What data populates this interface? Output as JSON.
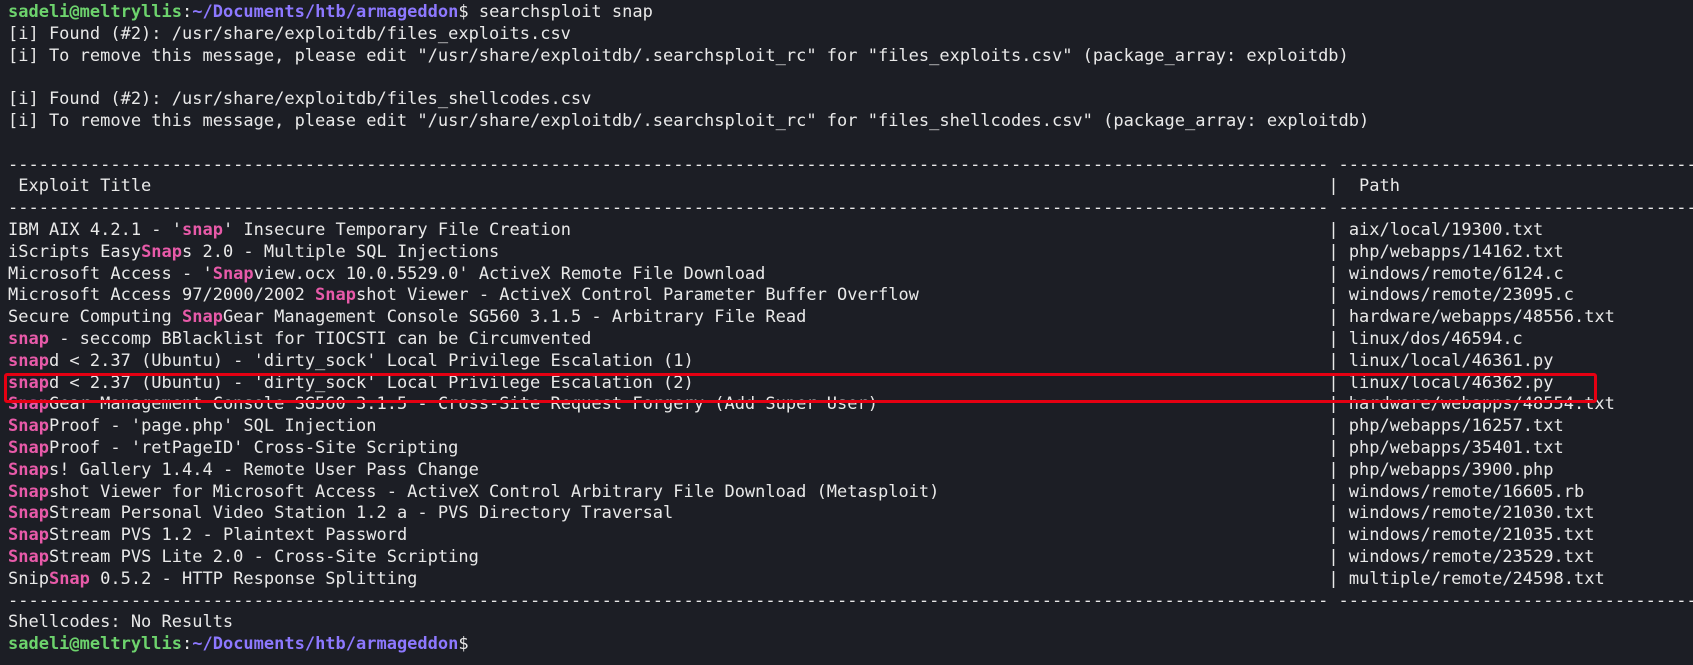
{
  "prompt": {
    "user_host": "sadeli@meltryllis",
    "separator": ":",
    "cwd": "~/Documents/htb/armageddon",
    "symbol": "$ ",
    "command": "searchsploit snap"
  },
  "messages": [
    "[i] Found (#2): /usr/share/exploitdb/files_exploits.csv",
    "[i] To remove this message, please edit \"/usr/share/exploitdb/.searchsploit_rc\" for \"files_exploits.csv\" (package_array: exploitdb)",
    "",
    "[i] Found (#2): /usr/share/exploitdb/files_shellcodes.csv",
    "[i] To remove this message, please edit \"/usr/share/exploitdb/.searchsploit_rc\" for \"files_shellcodes.csv\" (package_array: exploitdb)",
    ""
  ],
  "table": {
    "columns": [
      "Exploit Title",
      "Path"
    ],
    "rows": [
      {
        "pre": "IBM AIX 4.2.1 - '",
        "hl": "snap",
        "post": "' Insecure Temporary File Creation",
        "path": "aix/local/19300.txt"
      },
      {
        "pre": "iScripts Easy",
        "hl": "Snap",
        "post": "s 2.0 - Multiple SQL Injections",
        "path": "php/webapps/14162.txt"
      },
      {
        "pre": "Microsoft Access - '",
        "hl": "Snap",
        "post": "view.ocx 10.0.5529.0' ActiveX Remote File Download",
        "path": "windows/remote/6124.c"
      },
      {
        "pre": "Microsoft Access 97/2000/2002 ",
        "hl": "Snap",
        "post": "shot Viewer - ActiveX Control Parameter Buffer Overflow",
        "path": "windows/remote/23095.c"
      },
      {
        "pre": "Secure Computing ",
        "hl": "Snap",
        "post": "Gear Management Console SG560 3.1.5 - Arbitrary File Read",
        "path": "hardware/webapps/48556.txt"
      },
      {
        "pre": "",
        "hl": "snap",
        "post": " - seccomp BBlacklist for TIOCSTI can be Circumvented",
        "path": "linux/dos/46594.c"
      },
      {
        "pre": "",
        "hl": "snap",
        "post": "d < 2.37 (Ubuntu) - 'dirty_sock' Local Privilege Escalation (1)",
        "path": "linux/local/46361.py"
      },
      {
        "pre": "",
        "hl": "snap",
        "post": "d < 2.37 (Ubuntu) - 'dirty_sock' Local Privilege Escalation (2)",
        "path": "linux/local/46362.py"
      },
      {
        "pre": "",
        "hl": "Snap",
        "post": "Gear Management Console SG560 3.1.5 - Cross-Site Request Forgery (Add Super User)",
        "path": "hardware/webapps/48554.txt"
      },
      {
        "pre": "",
        "hl": "Snap",
        "post": "Proof - 'page.php' SQL Injection",
        "path": "php/webapps/16257.txt"
      },
      {
        "pre": "",
        "hl": "Snap",
        "post": "Proof - 'retPageID' Cross-Site Scripting",
        "path": "php/webapps/35401.txt"
      },
      {
        "pre": "",
        "hl": "Snap",
        "post": "s! Gallery 1.4.4 - Remote User Pass Change",
        "path": "php/webapps/3900.php"
      },
      {
        "pre": "",
        "hl": "Snap",
        "post": "shot Viewer for Microsoft Access - ActiveX Control Arbitrary File Download (Metasploit)",
        "path": "windows/remote/16605.rb"
      },
      {
        "pre": "",
        "hl": "Snap",
        "post": "Stream Personal Video Station 1.2 a - PVS Directory Traversal",
        "path": "windows/remote/21030.txt"
      },
      {
        "pre": "",
        "hl": "Snap",
        "post": "Stream PVS 1.2 - Plaintext Password",
        "path": "windows/remote/21035.txt"
      },
      {
        "pre": "",
        "hl": "Snap",
        "post": "Stream PVS Lite 2.0 - Cross-Site Scripting",
        "path": "windows/remote/23529.txt"
      },
      {
        "pre": "Snip",
        "hl": "Snap",
        "post": " 0.5.2 - HTTP Response Splitting",
        "path": "multiple/remote/24598.txt"
      }
    ],
    "highlighted_row_index": 7
  },
  "shellcodes": "Shellcodes: No Results",
  "colors": {
    "background": "#1c1e25",
    "text": "#e9e9e9",
    "user_host": "#6dd36d",
    "cwd": "#8d78ff",
    "match": "#e85aa9",
    "annotation_box": "#e50012"
  }
}
